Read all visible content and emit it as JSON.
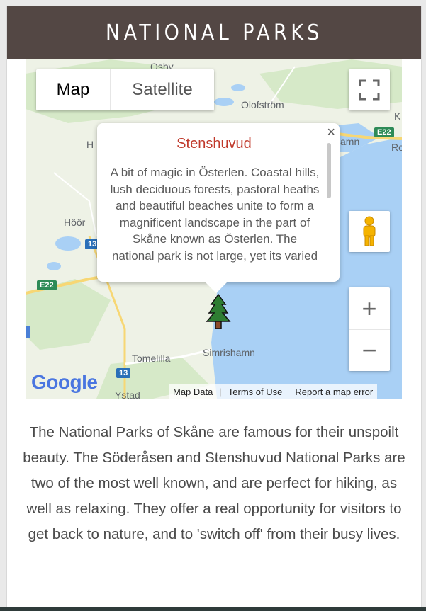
{
  "header": {
    "title": "NATIONAL PARKS"
  },
  "map": {
    "type_control": {
      "map_label": "Map",
      "satellite_label": "Satellite",
      "selected": "Map"
    },
    "places": {
      "osby": "Osby",
      "olofstrom": "Olofström",
      "hoor": "Höör",
      "tomelilla": "Tomelilla",
      "simrishamn": "Simrishamn",
      "ystad": "Ystad",
      "h": "H",
      "amn": "amn",
      "ro": "Ro",
      "k": "K"
    },
    "roads": {
      "e22_top": "E22",
      "e22_left": "E22",
      "r13_top": "13",
      "r13_bottom": "13"
    },
    "info_window": {
      "title": "Stenshuvud",
      "body": "A bit of magic in Österlen. Coastal hills, lush deciduous forests, pastoral heaths and beautiful beaches unite to form a magnificent landscape in the part of Skåne known as Österlen. The national park is not large, yet its varied nature offers",
      "close": "×"
    },
    "attribution": {
      "logo": "Google",
      "map_data": "Map Data",
      "terms": "Terms of Use",
      "report": "Report a map error"
    },
    "zoom": {
      "in": "+",
      "out": "−"
    },
    "icons": {
      "fullscreen": "fullscreen-icon",
      "pegman": "pegman-icon",
      "marker": "tree-marker-icon"
    },
    "colors": {
      "water": "#a9d0f5",
      "land": "#eef2e6",
      "forest": "#cfe6bf",
      "road": "#f7d774",
      "marker_title": "#c0392b"
    }
  },
  "description": "The National Parks of Skåne are famous for their unspoilt beauty. The Söderåsen and Stenshuvud National Parks are two of the most well known, and are perfect for hiking, as well as relaxing. They offer a real opportunity for visitors to get back to nature, and to 'switch off' from their busy lives.",
  "colors": {
    "header_bg": "#534744",
    "header_text": "#ffffff"
  }
}
